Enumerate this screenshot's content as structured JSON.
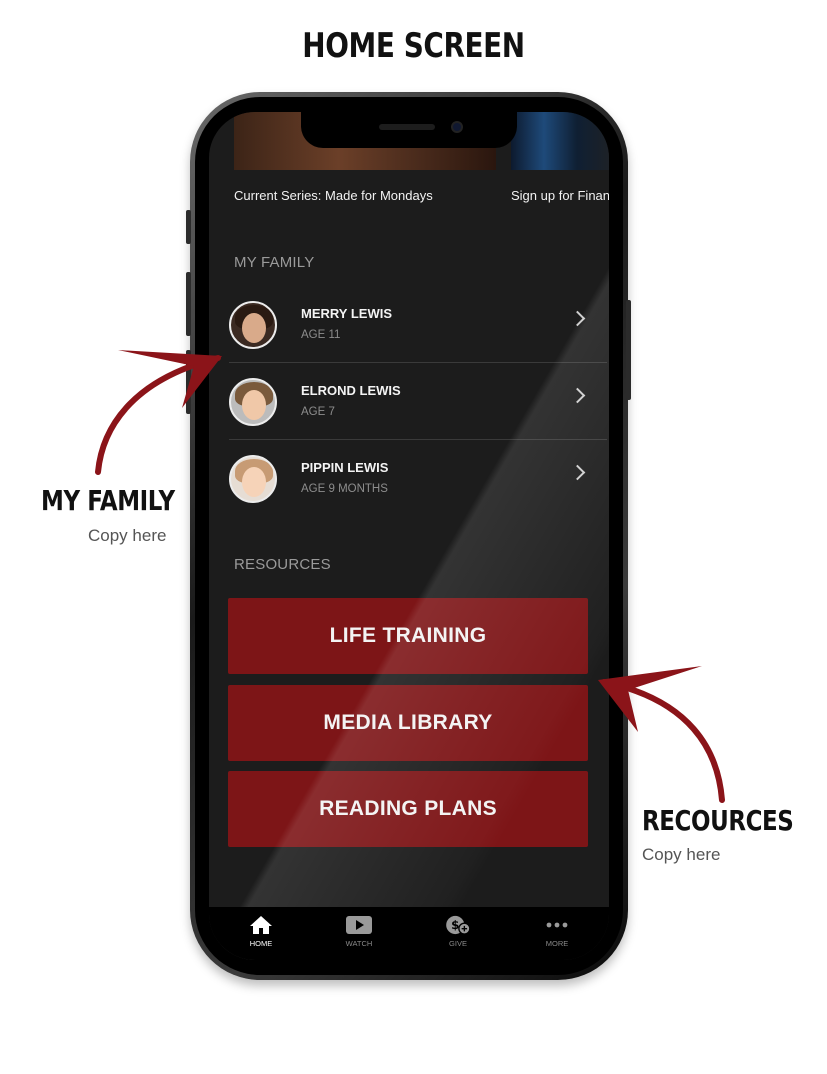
{
  "page_title": "HOME SCREEN",
  "banners": [
    {
      "caption": "Current Series: Made for Mondays"
    },
    {
      "caption": "Sign up for Finan"
    }
  ],
  "family": {
    "heading": "MY FAMILY",
    "members": [
      {
        "name": "MERRY LEWIS",
        "age": "AGE 11"
      },
      {
        "name": "ELROND LEWIS",
        "age": "AGE 7"
      },
      {
        "name": "PIPPIN LEWIS",
        "age": "AGE 9 MONTHS"
      }
    ]
  },
  "resources": {
    "heading": "RESOURCES",
    "buttons": [
      "LIFE TRAINING",
      "MEDIA LIBRARY",
      "READING PLANS"
    ]
  },
  "tabbar": {
    "tabs": [
      {
        "label": "HOME",
        "icon": "home-icon",
        "active": true
      },
      {
        "label": "WATCH",
        "icon": "play-icon",
        "active": false
      },
      {
        "label": "GIVE",
        "icon": "give-icon",
        "active": false
      },
      {
        "label": "MORE",
        "icon": "more-icon",
        "active": false
      }
    ]
  },
  "annotations": {
    "family_title": "MY FAMILY",
    "family_copy": "Copy here",
    "resources_title": "RECOURCES",
    "resources_copy": "Copy here"
  },
  "colors": {
    "accent_red": "#7d1517",
    "arrow_red": "#8b1419",
    "screen_bg": "#1c1c1c"
  }
}
